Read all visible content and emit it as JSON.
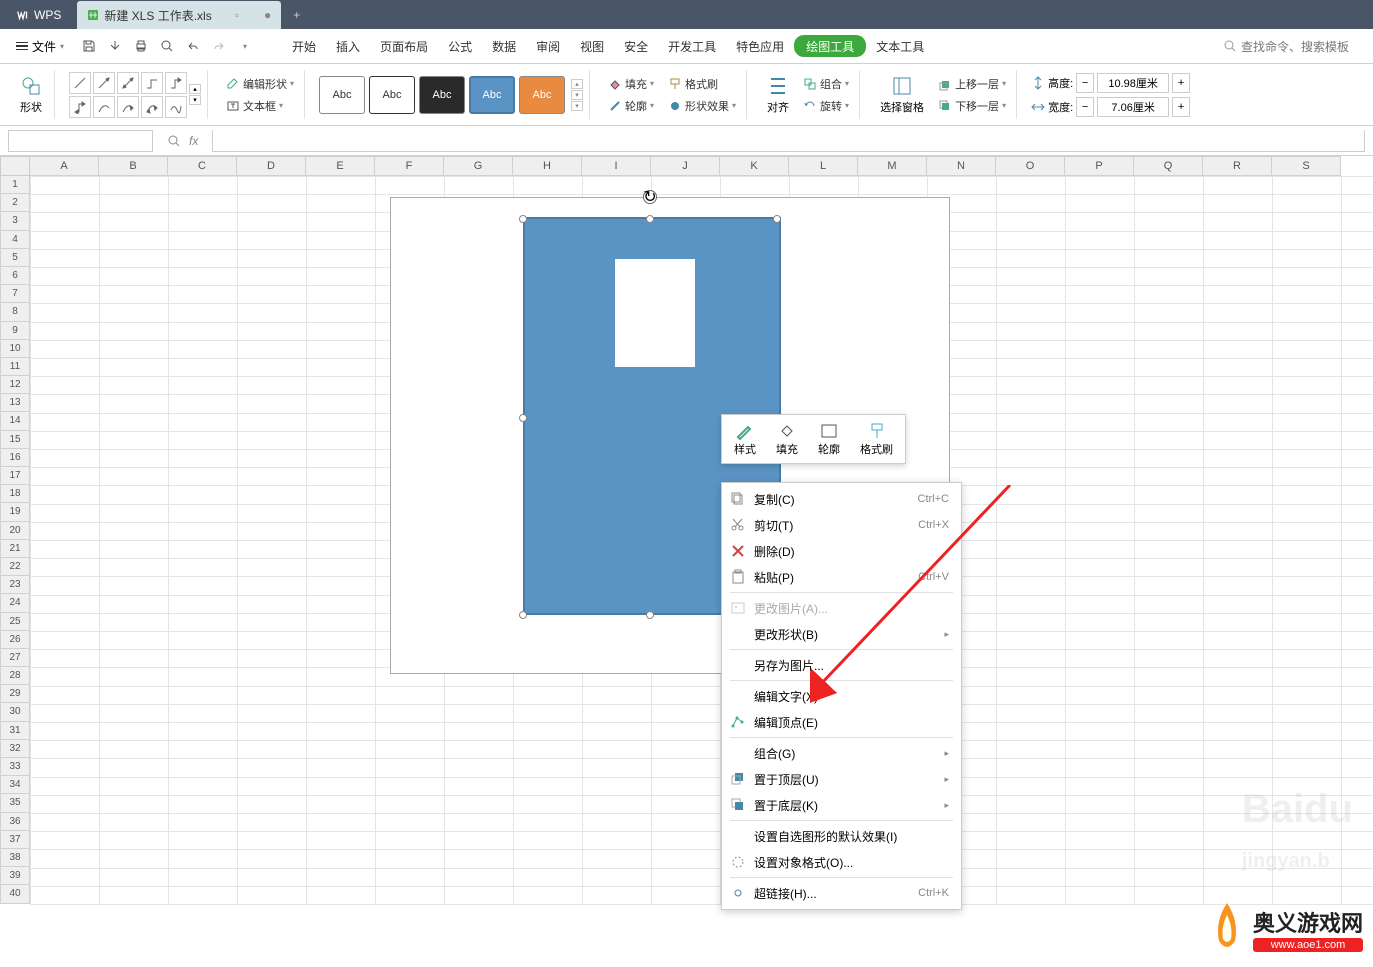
{
  "titlebar": {
    "wps": "WPS",
    "doc_title": "新建 XLS 工作表.xls"
  },
  "menubar": {
    "file": "文件",
    "tabs": [
      "开始",
      "插入",
      "页面布局",
      "公式",
      "数据",
      "审阅",
      "视图",
      "安全",
      "开发工具",
      "特色应用",
      "绘图工具",
      "文本工具"
    ],
    "search_hint": "查找命令、搜索模板"
  },
  "ribbon": {
    "shape": "形状",
    "edit_shape": "编辑形状",
    "textbox": "文本框",
    "style_label": "Abc",
    "fill": "填充",
    "outline": "轮廓",
    "format_painter": "格式刷",
    "shape_effects": "形状效果",
    "align": "对齐",
    "group": "组合",
    "rotate": "旋转",
    "select_pane": "选择窗格",
    "bring_forward": "上移一层",
    "send_backward": "下移一层",
    "height_label": "高度:",
    "width_label": "宽度:",
    "height_val": "10.98厘米",
    "width_val": "7.06厘米"
  },
  "mini_toolbar": {
    "style": "样式",
    "fill": "填充",
    "outline": "轮廓",
    "format_painter": "格式刷"
  },
  "context_menu": {
    "copy": "复制(C)",
    "copy_sc": "Ctrl+C",
    "cut": "剪切(T)",
    "cut_sc": "Ctrl+X",
    "delete": "删除(D)",
    "paste": "粘贴(P)",
    "paste_sc": "Ctrl+V",
    "change_pic": "更改图片(A)...",
    "change_shape": "更改形状(B)",
    "save_as_pic": "另存为图片...",
    "edit_text": "编辑文字(X)",
    "edit_points": "编辑顶点(E)",
    "group": "组合(G)",
    "bring_top": "置于顶层(U)",
    "send_bottom": "置于底层(K)",
    "default_effect": "设置自选图形的默认效果(I)",
    "format_object": "设置对象格式(O)...",
    "hyperlink": "超链接(H)...",
    "hyperlink_sc": "Ctrl+K"
  },
  "columns": [
    "A",
    "B",
    "C",
    "D",
    "E",
    "F",
    "G",
    "H",
    "I",
    "J",
    "K",
    "L",
    "M",
    "N",
    "O",
    "P",
    "Q",
    "R",
    "S"
  ],
  "rows": 40,
  "brand": {
    "name": "奥义游戏网",
    "url": "www.aoe1.com"
  }
}
